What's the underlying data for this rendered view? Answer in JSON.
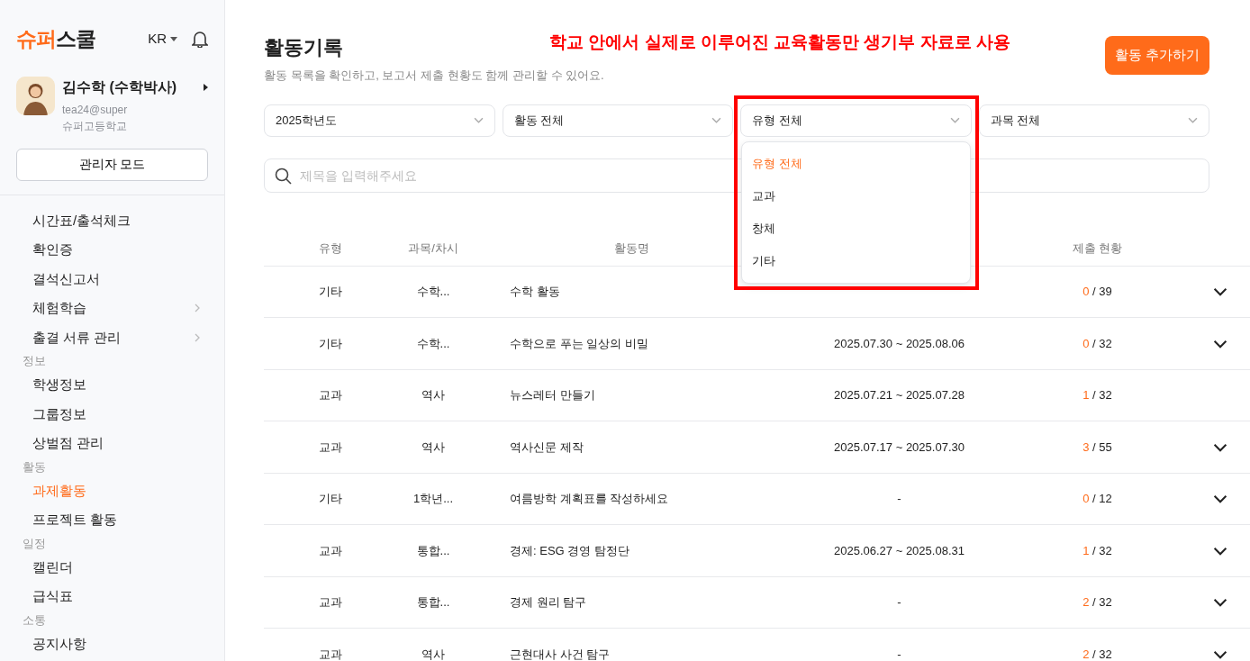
{
  "sidebar": {
    "logo": {
      "accent": "슈퍼",
      "rest": "스쿨"
    },
    "language": "KR",
    "profile": {
      "name": "김수학 (수학박사)",
      "email": "tea24@super",
      "school": "슈퍼고등학교"
    },
    "admin_button": "관리자 모드",
    "groups": [
      {
        "items": [
          {
            "label": "시간표/출석체크",
            "selected": false,
            "submenu": false
          },
          {
            "label": "확인증",
            "selected": false,
            "submenu": false
          },
          {
            "label": "결석신고서",
            "selected": false,
            "submenu": false
          },
          {
            "label": "체험학습",
            "selected": false,
            "submenu": true
          },
          {
            "label": "출결 서류 관리",
            "selected": false,
            "submenu": true
          }
        ]
      },
      {
        "title": "정보",
        "items": [
          {
            "label": "학생정보",
            "selected": false,
            "submenu": false
          },
          {
            "label": "그룹정보",
            "selected": false,
            "submenu": false
          },
          {
            "label": "상벌점 관리",
            "selected": false,
            "submenu": false
          }
        ]
      },
      {
        "title": "활동",
        "items": [
          {
            "label": "과제활동",
            "selected": true,
            "submenu": false
          },
          {
            "label": "프로젝트 활동",
            "selected": false,
            "submenu": false
          }
        ]
      },
      {
        "title": "일정",
        "items": [
          {
            "label": "캘린더",
            "selected": false,
            "submenu": false
          },
          {
            "label": "급식표",
            "selected": false,
            "submenu": false
          }
        ]
      },
      {
        "title": "소통",
        "items": [
          {
            "label": "공지사항",
            "selected": false,
            "submenu": false
          }
        ]
      }
    ]
  },
  "page": {
    "title": "활동기록",
    "subtitle": "활동 목록을 확인하고, 보고서 제출 현황도 함께 관리할 수 있어요.",
    "add_button": "활동 추가하기"
  },
  "annotation": {
    "text": "학교 안에서 실제로 이루어진 교육활동만 생기부 자료로 사용"
  },
  "filters": [
    {
      "value": "2025학년도",
      "open": false
    },
    {
      "value": "활동 전체",
      "open": false
    },
    {
      "value": "유형 전체",
      "open": true,
      "options": [
        {
          "label": "유형 전체",
          "selected": true
        },
        {
          "label": "교과",
          "selected": false
        },
        {
          "label": "창체",
          "selected": false
        },
        {
          "label": "기타",
          "selected": false
        }
      ]
    },
    {
      "value": "과목 전체",
      "open": false
    }
  ],
  "search": {
    "placeholder": "제목을 입력해주세요"
  },
  "table": {
    "columns": [
      "유형",
      "과목/차시",
      "활동명",
      "",
      "제출 현황"
    ],
    "rows": [
      {
        "type": "기타",
        "subject": "수학...",
        "name": "수학 활동",
        "submitted": "0",
        "total": "/ 39",
        "expandable": true
      },
      {
        "type": "기타",
        "subject": "수학...",
        "name": "수학으로 푸는 일상의 비밀",
        "period": "2025.07.30 ~ 2025.08.06",
        "submitted": "0",
        "total": "/ 32",
        "expandable": true
      },
      {
        "type": "교과",
        "subject": "역사",
        "name": "뉴스레터 만들기",
        "period": "2025.07.21 ~ 2025.07.28",
        "submitted": "1",
        "total": "/ 32",
        "expandable": false
      },
      {
        "type": "교과",
        "subject": "역사",
        "name": "역사신문 제작",
        "period": "2025.07.17 ~ 2025.07.30",
        "submitted": "3",
        "total": "/ 55",
        "expandable": true
      },
      {
        "type": "기타",
        "subject": "1학년...",
        "name": "여름방학 계획표를 작성하세요",
        "period": "-",
        "submitted": "0",
        "total": "/ 12",
        "expandable": true
      },
      {
        "type": "교과",
        "subject": "통합...",
        "name": "경제: ESG 경영 탐정단",
        "period": "2025.06.27 ~ 2025.08.31",
        "submitted": "1",
        "total": "/ 32",
        "expandable": true
      },
      {
        "type": "교과",
        "subject": "통합...",
        "name": "경제 원리 탐구",
        "period": "-",
        "submitted": "2",
        "total": "/ 32",
        "expandable": true
      },
      {
        "type": "교과",
        "subject": "역사",
        "name": "근현대사 사건 탐구",
        "period": "-",
        "submitted": "2",
        "total": "/ 32",
        "expandable": true
      }
    ]
  }
}
